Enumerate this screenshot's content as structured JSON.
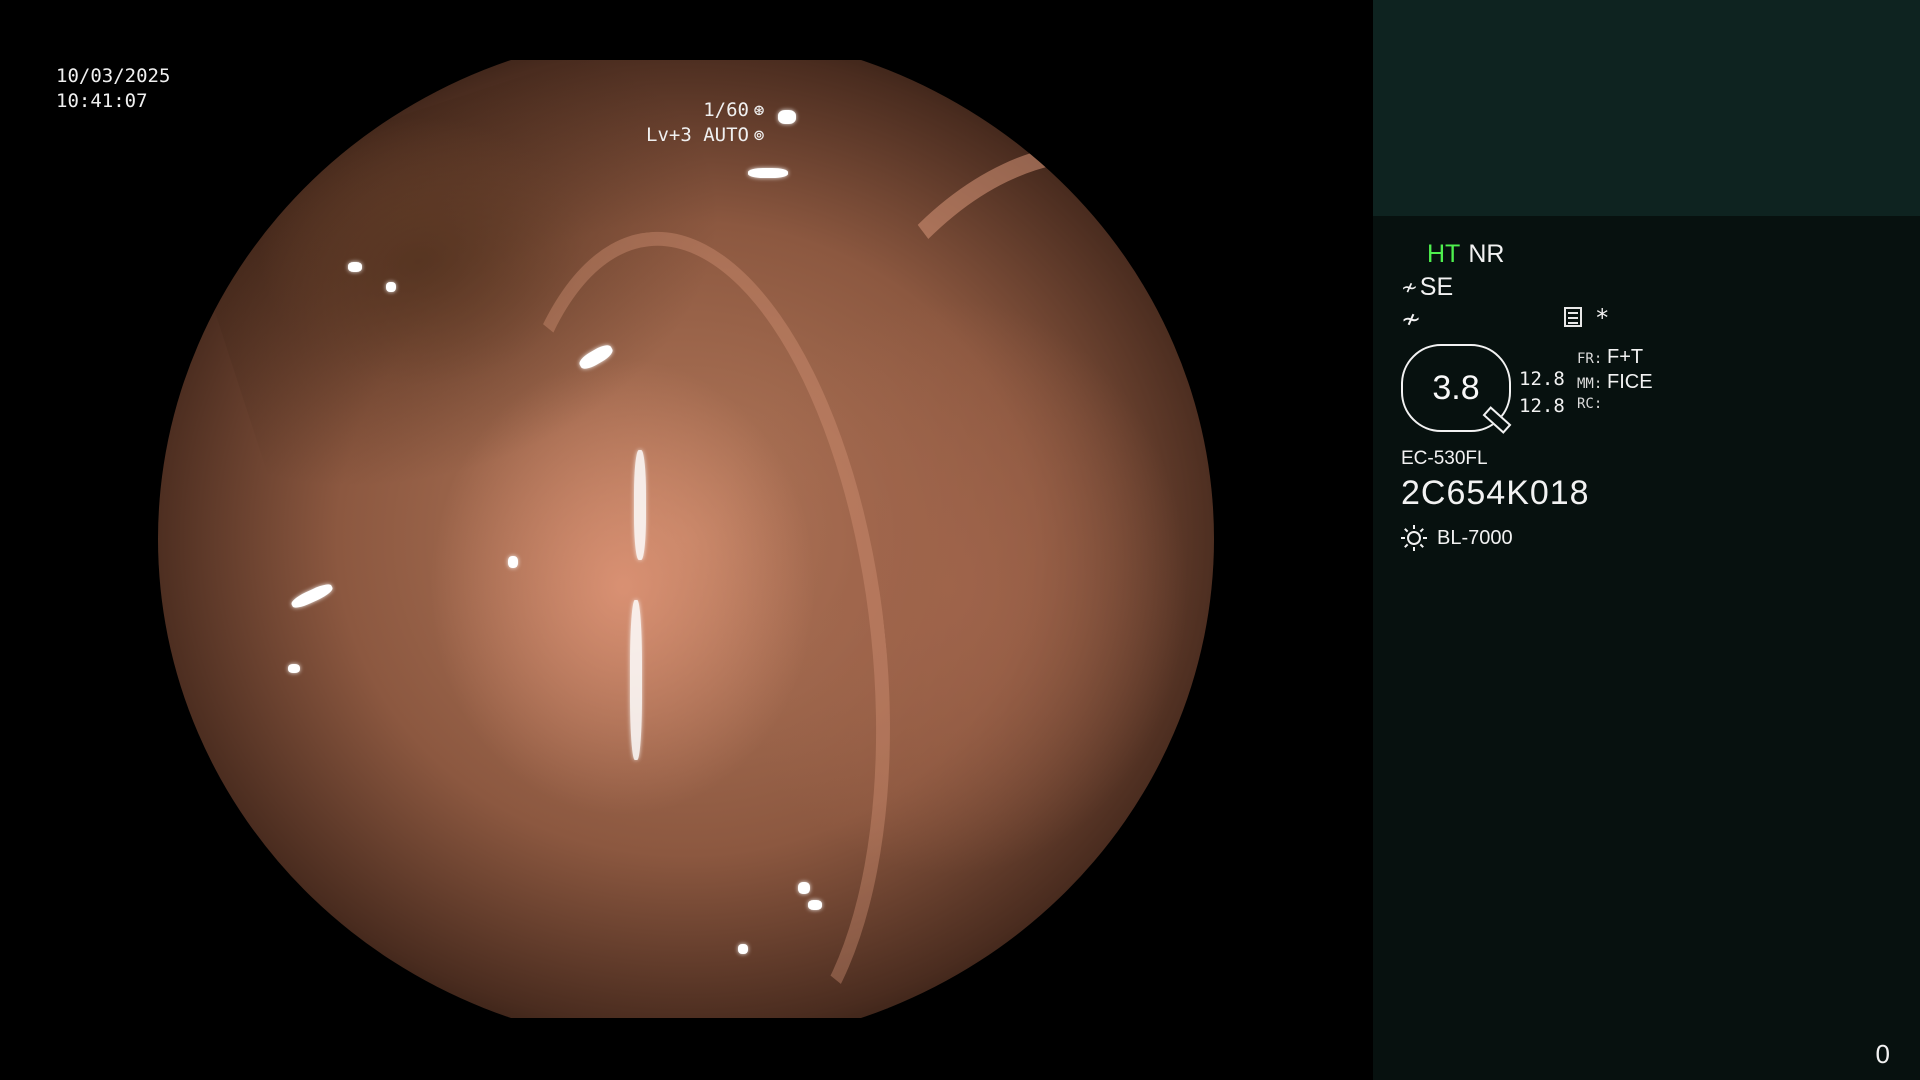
{
  "osd": {
    "date": "10/03/2025",
    "time": "10:41:07",
    "shutter": "1/60",
    "shutter_icon": "shutter-icon",
    "level_mode": "Lv+3 AUTO",
    "auto_icon": "auto-iris-icon"
  },
  "panel": {
    "ht_label": "HT",
    "nr_label": "NR",
    "se_icon": "structure-enhancement-icon",
    "se_label": "SE",
    "color_icon": "color-tone-icon",
    "menu_icon": "menu-icon",
    "star_label": "*",
    "gauge": {
      "value": "3.8",
      "value_top": "12.8",
      "value_bottom": "12.8",
      "fr_key": "FR:",
      "fr_val": "F+T",
      "mm_key": "MM:",
      "mm_val": "FICE",
      "rc_key": "RC:",
      "rc_val": ""
    },
    "scope_model": "EC-530FL",
    "scope_serial": "2C654K018",
    "light_icon": "light-source-icon",
    "light_source": "BL-7000",
    "counter": "0"
  },
  "colors": {
    "background": "#000000",
    "panel_bg": "#07110f",
    "panel_top_bg": "#0e2320",
    "ht_green": "#4ef04e",
    "text": "#f2f2f2",
    "tissue": "#b57a5c"
  }
}
